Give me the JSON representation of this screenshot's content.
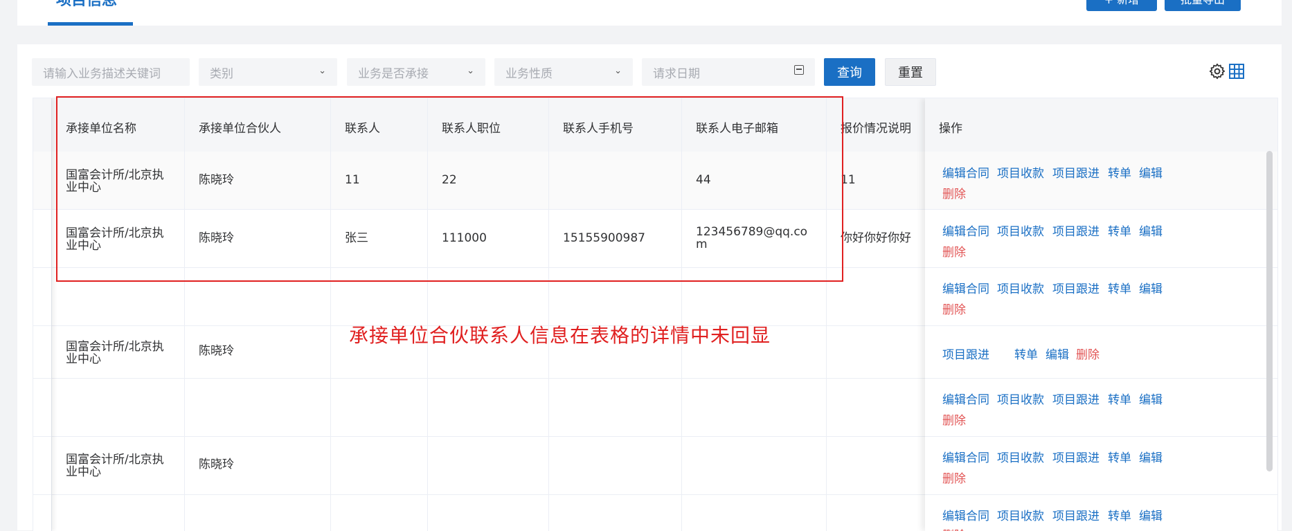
{
  "header": {
    "tab_title": "项目信息",
    "buttons": [
      "+ 新增",
      "批量导出"
    ]
  },
  "filters": {
    "keyword_placeholder": "请输入业务描述关键词",
    "category_placeholder": "类别",
    "undertake_placeholder": "业务是否承接",
    "nature_placeholder": "业务性质",
    "date_placeholder": "请求日期",
    "query_label": "查询",
    "reset_label": "重置"
  },
  "table": {
    "columns": [
      "承接单位名称",
      "承接单位合伙人",
      "联系人",
      "联系人职位",
      "联系人手机号",
      "联系人电子邮箱",
      "报价情况说明",
      "操作"
    ],
    "rows": [
      {
        "unit_l1": "国富会计所/北京执",
        "unit_l2": "业中心",
        "partner": "陈晓玲",
        "contact": "11",
        "position": "22",
        "phone": "",
        "email_l1": "44",
        "email_l2": "",
        "quote": "11"
      },
      {
        "unit_l1": "国富会计所/北京执",
        "unit_l2": "业中心",
        "partner": "陈晓玲",
        "contact": "张三",
        "position": "111000",
        "phone": "15155900987",
        "email_l1": "123456789@qq.co",
        "email_l2": "m",
        "quote": "你好你好你好"
      },
      {
        "unit_l1": "",
        "unit_l2": "",
        "partner": "",
        "contact": "",
        "position": "",
        "phone": "",
        "email_l1": "",
        "email_l2": "",
        "quote": ""
      },
      {
        "unit_l1": "国富会计所/北京执",
        "unit_l2": "业中心",
        "partner": "陈晓玲",
        "contact": "",
        "position": "",
        "phone": "",
        "email_l1": "",
        "email_l2": "",
        "quote": ""
      },
      {
        "unit_l1": "",
        "unit_l2": "",
        "partner": "",
        "contact": "",
        "position": "",
        "phone": "",
        "email_l1": "",
        "email_l2": "",
        "quote": ""
      },
      {
        "unit_l1": "国富会计所/北京执",
        "unit_l2": "业中心",
        "partner": "陈晓玲",
        "contact": "",
        "position": "",
        "phone": "",
        "email_l1": "",
        "email_l2": "",
        "quote": ""
      },
      {
        "unit_l1": "",
        "unit_l2": "",
        "partner": "",
        "contact": "",
        "position": "",
        "phone": "",
        "email_l1": "",
        "email_l2": "",
        "quote": ""
      }
    ],
    "actions": {
      "edit_contract": "编辑合同",
      "collect": "项目收款",
      "follow_up": "项目跟进",
      "transfer": "转单",
      "edit": "编辑",
      "delete": "删除"
    }
  },
  "annotation": {
    "note": "承接单位合伙联系人信息在表格的详情中未回显",
    "color": "#e02020"
  },
  "icons": [
    "chevron-down-icon",
    "calendar-icon",
    "gear-icon",
    "grid-icon"
  ],
  "colors": {
    "primary": "#1a6fc4",
    "danger": "#e25555"
  }
}
